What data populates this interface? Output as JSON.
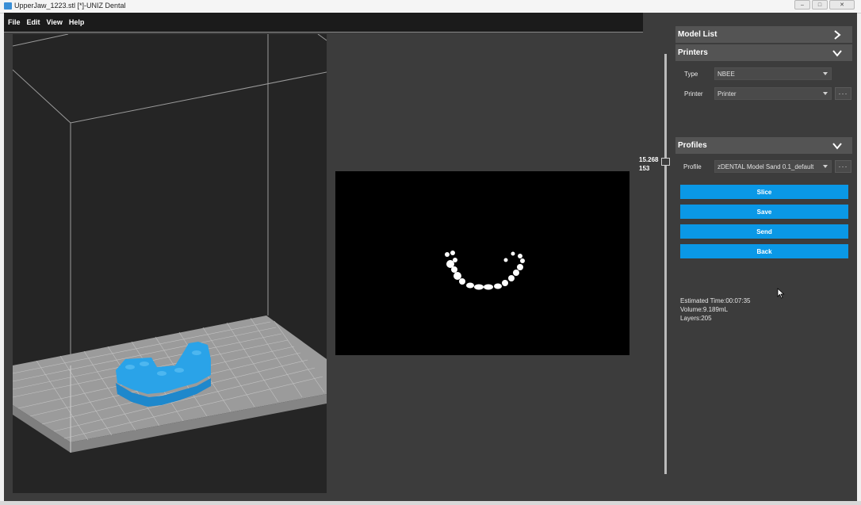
{
  "window": {
    "title": "UpperJaw_1223.stl [*]-UNIZ Dental",
    "buttons": [
      "–",
      "□",
      "✕"
    ]
  },
  "menu": {
    "items": [
      {
        "label": "File"
      },
      {
        "label": "Edit"
      },
      {
        "label": "View"
      },
      {
        "label": "Help"
      }
    ]
  },
  "slider": {
    "height_value": "15.268",
    "layer_value": "153"
  },
  "panel": {
    "model_list": {
      "label": "Model List",
      "icon": "chevron-right-icon"
    },
    "printers": {
      "label": "Printers",
      "icon": "chevron-down-icon",
      "type_label": "Type",
      "type_value": "NBEE",
      "printer_label": "Printer",
      "printer_value": "Printer",
      "more_label": "···"
    },
    "profiles": {
      "label": "Profiles",
      "icon": "chevron-down-icon",
      "profile_label": "Profile",
      "profile_value": "zDENTAL Model Sand 0.1_default",
      "more_label": "···"
    },
    "actions": {
      "slice": "Slice",
      "save": "Save",
      "send": "Send",
      "back": "Back"
    },
    "info": {
      "estimated_time": "Estimated Time:00:07:35",
      "volume": "Volume:9.189mL",
      "layers": "Layers:205"
    }
  },
  "colors": {
    "accent": "#0a98e6",
    "model": "#2aa3e8",
    "panel_bg": "#3c3c3c",
    "header_bg": "#545454"
  }
}
